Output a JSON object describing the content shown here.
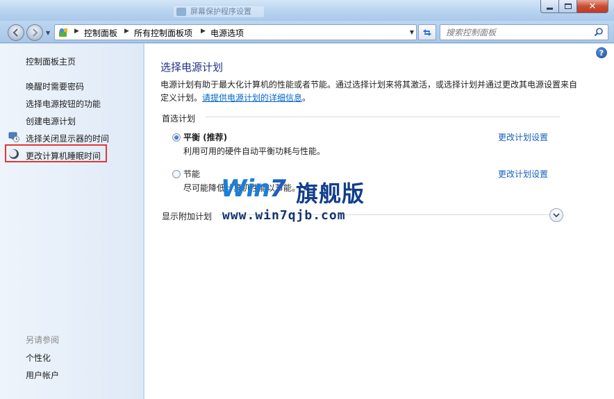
{
  "window": {
    "ghost_title": "屏幕保护程序设置",
    "caption": {
      "minimize": "–",
      "maximize": "□",
      "close": "✕"
    }
  },
  "nav": {
    "back_icon": "back-arrow-icon",
    "forward_icon": "forward-arrow-icon",
    "breadcrumbs": [
      "控制面板",
      "所有控制面板项",
      "电源选项"
    ],
    "search_placeholder": "搜索控制面板"
  },
  "sidebar": {
    "home": "控制面板主页",
    "items": [
      {
        "label": "唤醒时需要密码",
        "icon": ""
      },
      {
        "label": "选择电源按钮的功能",
        "icon": ""
      },
      {
        "label": "创建电源计划",
        "icon": ""
      },
      {
        "label": "选择关闭显示器的时间",
        "icon": "monitor-clock-icon"
      },
      {
        "label": "更改计算机睡眠时间",
        "icon": "moon-sleep-icon"
      }
    ],
    "see_also_title": "另请参阅",
    "see_also": [
      "个性化",
      "用户帐户"
    ]
  },
  "main": {
    "title": "选择电源计划",
    "description": "电源计划有助于最大化计算机的性能或者节能。通过选择计划来将其激活，或选择计划并通过更改其电源设置来自定义计划。",
    "description_link": "请提供电源计划的详细信息",
    "description_end": "。",
    "preferred_plans_label": "首选计划",
    "plans": [
      {
        "name": "平衡 (推荐)",
        "desc": "利用可用的硬件自动平衡功耗与性能。",
        "link": "更改计划设置",
        "selected": true
      },
      {
        "name": "节能",
        "desc": "尽可能降低计算机性能以节能。",
        "link": "更改计划设置",
        "selected": false
      }
    ],
    "show_additional": "显示附加计划"
  },
  "watermark": {
    "logo_win": "Win",
    "logo_seven": "7",
    "logo_cn": "旗舰版",
    "url": "www.win7qjb.com"
  },
  "colors": {
    "title_blue": "#1e3287",
    "link_blue": "#1560bd",
    "highlight_red": "#e53535"
  }
}
